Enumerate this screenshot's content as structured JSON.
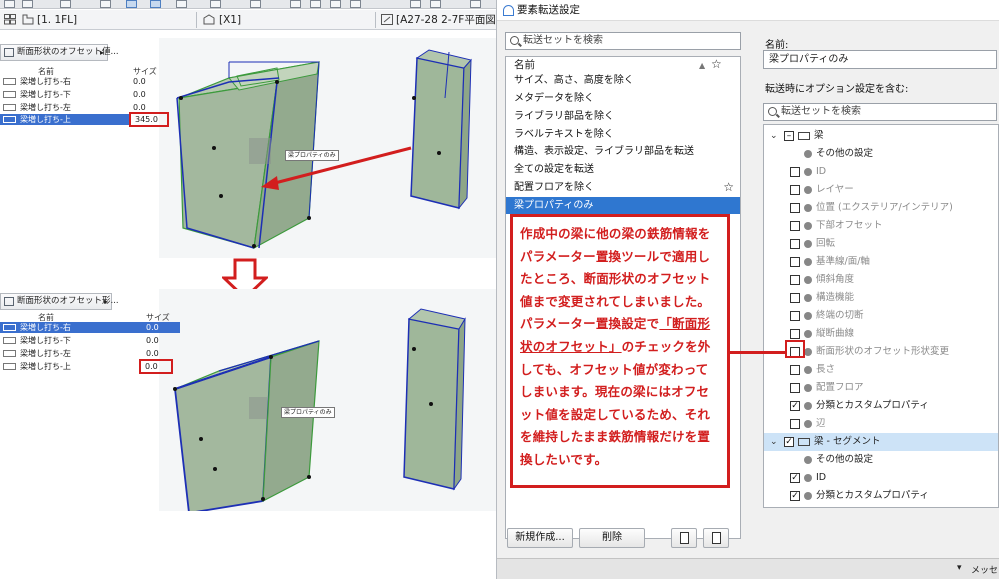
{
  "left": {
    "tabs": [
      {
        "label": "[1. 1FL]"
      },
      {
        "label": "[X1]"
      },
      {
        "label": "[A27-28 2-7F平面図詳"
      }
    ],
    "panel_top": {
      "title": "断面形状のオフセット値...",
      "col_name": "名前",
      "col_size": "サイズ",
      "rows": [
        {
          "name": "梁増し打ち-右",
          "value": "0.0"
        },
        {
          "name": "梁増し打ち-下",
          "value": "0.0"
        },
        {
          "name": "梁増し打ち-左",
          "value": "0.0"
        },
        {
          "name": "梁増し打ち-上",
          "value": "345.0"
        }
      ]
    },
    "panel_bottom": {
      "title": "断面形状のオフセット形...",
      "col_name": "名前",
      "col_size": "サイズ",
      "rows": [
        {
          "name": "梁増し打ち-右",
          "value": "0.0"
        },
        {
          "name": "梁増し打ち-下",
          "value": "0.0"
        },
        {
          "name": "梁増し打ち-左",
          "value": "0.0"
        },
        {
          "name": "梁増し打ち-上",
          "value": "0.0"
        }
      ]
    },
    "beam_tag_top": "梁プロパティのみ",
    "beam_tag_bottom": "梁プロパティのみ"
  },
  "dialog": {
    "title": "要素転送設定",
    "search_placeholder": "転送セットを検索",
    "list_header": "名前",
    "list_items": [
      {
        "label": "サイズ、高さ、高度を除く",
        "star": ""
      },
      {
        "label": "メタデータを除く",
        "star": ""
      },
      {
        "label": "ライブラリ部品を除く",
        "star": ""
      },
      {
        "label": "ラベルテキストを除く",
        "star": ""
      },
      {
        "label": "構造、表示設定、ライブラリ部品を転送",
        "star": ""
      },
      {
        "label": "全ての設定を転送",
        "star": ""
      },
      {
        "label": "配置フロアを除く",
        "star": "☆"
      },
      {
        "label": "梁プロパティのみ",
        "star": ""
      }
    ],
    "header_star": "☆",
    "buttons": {
      "new": "新規作成...",
      "delete": "削除"
    },
    "name_label": "名前:",
    "name_value": "梁プロパティのみ",
    "options_label": "転送時にオプション設定を含む:",
    "options_search_placeholder": "転送セットを検索",
    "tree": [
      {
        "label": "梁",
        "kind": "group",
        "level": 0,
        "checked": "partial",
        "enabled": true
      },
      {
        "label": "その他の設定",
        "kind": "item",
        "level": 1,
        "checked": "none",
        "enabled": true
      },
      {
        "label": "ID",
        "kind": "item",
        "level": 1,
        "checked": "off",
        "enabled": false
      },
      {
        "label": "レイヤー",
        "kind": "item",
        "level": 1,
        "checked": "off",
        "enabled": false
      },
      {
        "label": "位置 (エクステリア/インテリア)",
        "kind": "item",
        "level": 1,
        "checked": "off",
        "enabled": false
      },
      {
        "label": "下部オフセット",
        "kind": "item",
        "level": 1,
        "checked": "off",
        "enabled": false
      },
      {
        "label": "回転",
        "kind": "item",
        "level": 1,
        "checked": "off",
        "enabled": false
      },
      {
        "label": "基準線/面/軸",
        "kind": "item",
        "level": 1,
        "checked": "off",
        "enabled": false
      },
      {
        "label": "傾斜角度",
        "kind": "item",
        "level": 1,
        "checked": "off",
        "enabled": false
      },
      {
        "label": "構造機能",
        "kind": "item",
        "level": 1,
        "checked": "off",
        "enabled": false
      },
      {
        "label": "終端の切断",
        "kind": "item",
        "level": 1,
        "checked": "off",
        "enabled": false
      },
      {
        "label": "縦断曲線",
        "kind": "item",
        "level": 1,
        "checked": "off",
        "enabled": false
      },
      {
        "label": "断面形状のオフセット形状変更",
        "kind": "item",
        "level": 1,
        "checked": "off",
        "enabled": false
      },
      {
        "label": "長さ",
        "kind": "item",
        "level": 1,
        "checked": "off",
        "enabled": false
      },
      {
        "label": "配置フロア",
        "kind": "item",
        "level": 1,
        "checked": "off",
        "enabled": false
      },
      {
        "label": "分類とカスタムプロパティ",
        "kind": "item",
        "level": 1,
        "checked": "on",
        "enabled": true
      },
      {
        "label": "辺",
        "kind": "item",
        "level": 1,
        "checked": "off",
        "enabled": false
      },
      {
        "label": "梁 - セグメント",
        "kind": "group",
        "level": 0,
        "checked": "on",
        "enabled": true
      },
      {
        "label": "その他の設定",
        "kind": "item",
        "level": 1,
        "checked": "none",
        "enabled": true
      },
      {
        "label": "ID",
        "kind": "item",
        "level": 1,
        "checked": "on",
        "enabled": true
      },
      {
        "label": "分類とカスタムプロパティ",
        "kind": "item",
        "level": 1,
        "checked": "on",
        "enabled": true
      }
    ],
    "status_text": "メッセ"
  },
  "note": {
    "part1": "作成中の梁に他の梁の鉄筋情報をパラメーター置換ツールで適用したところ、断面形状のオフセット値まで変更されてしまいました。パラメーター置換設定で",
    "part2": "「断面形状のオフセット」",
    "part3": "のチェックを外しても、オフセット値が変わってしまいます。現在の梁にはオフセット値を設定しているため、それを維持したまま鉄筋情報だけを置換したいです。"
  },
  "colors": {
    "accent": "#2f77d0",
    "annotation": "#d21e1e",
    "beam_fill": "#9fb79a"
  }
}
